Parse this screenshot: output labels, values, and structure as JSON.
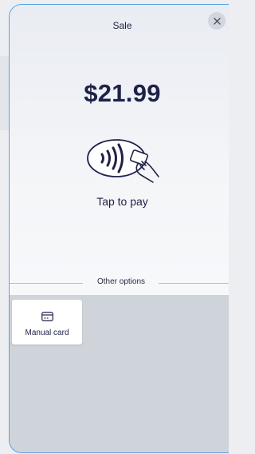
{
  "sheet": {
    "title": "Sale",
    "close_icon": "close-icon"
  },
  "payment": {
    "amount": "$21.99",
    "illustration_icon": "contactless-tap-icon",
    "tap_label": "Tap to pay"
  },
  "other_options": {
    "label": "Other options",
    "options": [
      {
        "label": "Manual card",
        "icon": "credit-card-icon"
      }
    ]
  },
  "colors": {
    "accent_border": "#5aa3e0",
    "text_primary": "#1e2148",
    "panel_bottom": "#cfd3da"
  }
}
